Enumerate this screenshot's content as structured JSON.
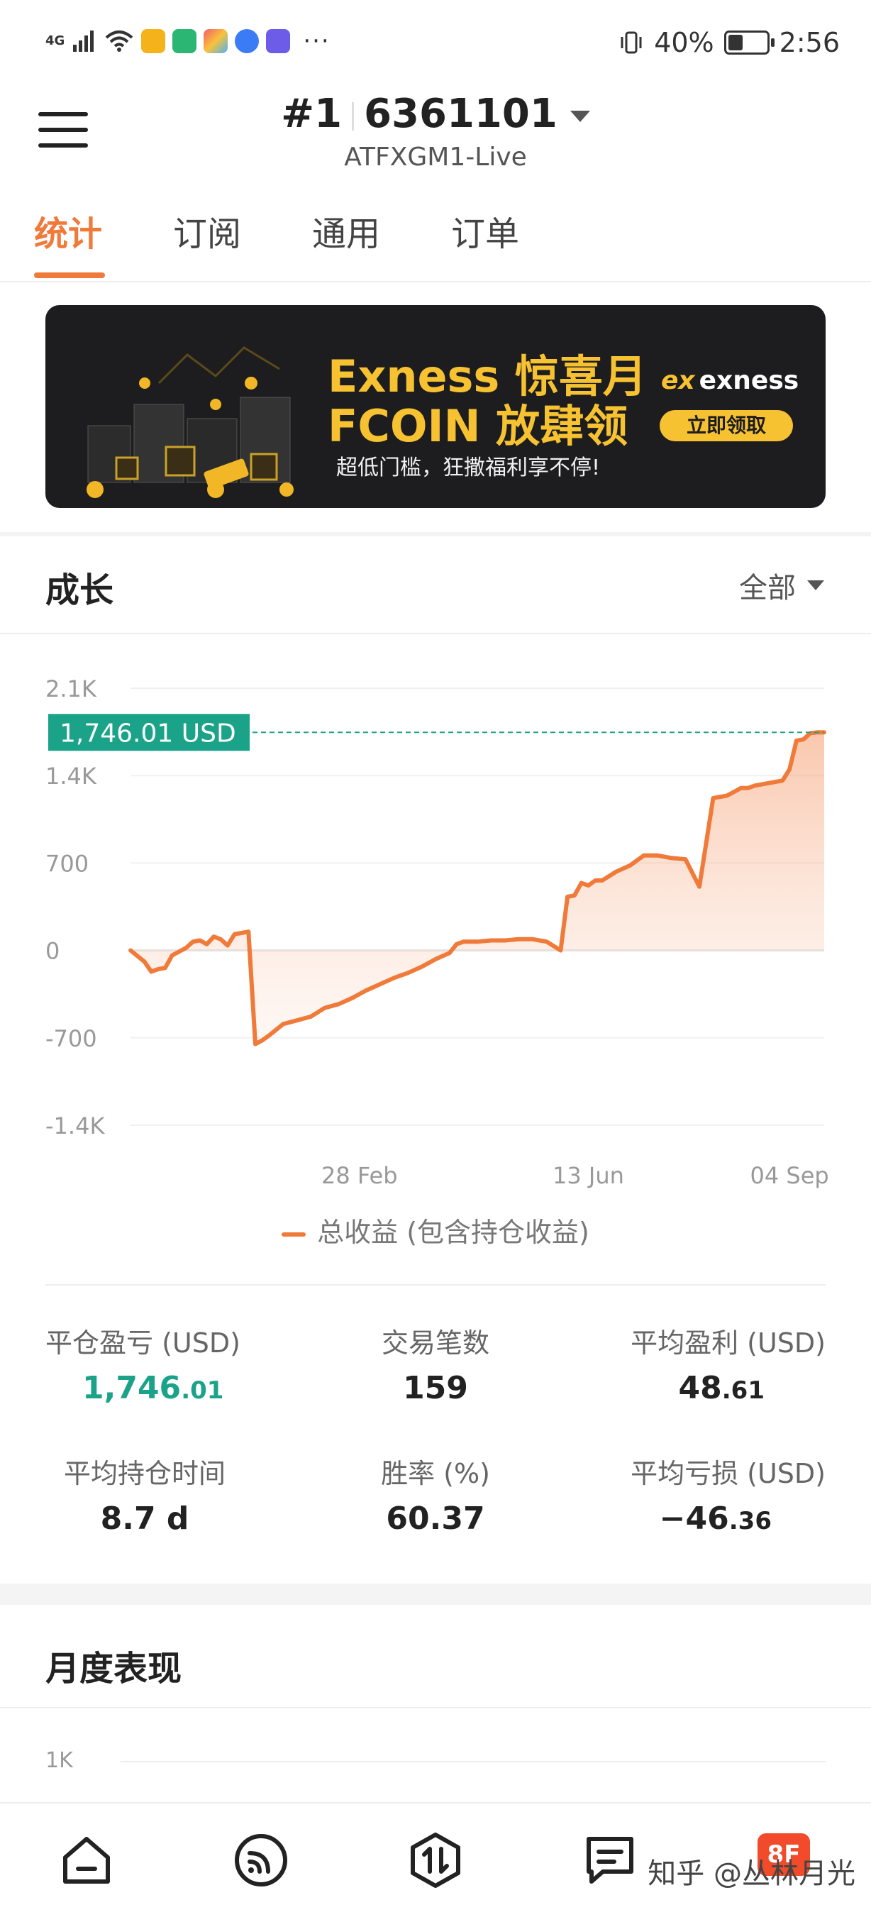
{
  "status_bar": {
    "network": "4G",
    "battery": "40%",
    "battery_level": 0.4,
    "time": "2:56",
    "overflow": "···"
  },
  "header": {
    "account_prefix": "#1",
    "account_number": "6361101",
    "server": "ATFXGM1-Live"
  },
  "tabs": [
    {
      "label": "统计",
      "active": true
    },
    {
      "label": "订阅",
      "active": false
    },
    {
      "label": "通用",
      "active": false
    },
    {
      "label": "订单",
      "active": false
    }
  ],
  "banner": {
    "title_line1": "Exness 惊喜月",
    "title_line2": "FCOIN 放肆领",
    "subtitle": "超低门槛，狂撒福利享不停!",
    "logo": "exness",
    "logo_mark": "ex",
    "button": "立即领取",
    "colors": {
      "background": "#1d1d1f",
      "accent": "#f7c231"
    }
  },
  "growth": {
    "title": "成长",
    "filter": "全部",
    "current_label": "1,746.01 USD",
    "legend": "总收益 (包含持仓收益)"
  },
  "chart_data": {
    "type": "area",
    "y_tick_labels": [
      "2.1K",
      "1.4K",
      "700",
      "0",
      "-700",
      "-1.4K"
    ],
    "y_ticks": [
      2100,
      1400,
      700,
      0,
      -700,
      -1400
    ],
    "ylim": [
      -1400,
      2100
    ],
    "x_tick_labels": [
      "28 Feb",
      "13 Jun",
      "04 Sep"
    ],
    "x_ticks": [
      0.33,
      0.66,
      0.95
    ],
    "current_value": 1746.01,
    "line_color": "#f07a3a",
    "reference_color": "#1ba38a",
    "series": [
      {
        "name": "总收益 (包含持仓收益)",
        "x": [
          0,
          0.02,
          0.03,
          0.04,
          0.05,
          0.06,
          0.08,
          0.09,
          0.1,
          0.11,
          0.12,
          0.13,
          0.14,
          0.15,
          0.16,
          0.17,
          0.18,
          0.19,
          0.2,
          0.22,
          0.24,
          0.26,
          0.28,
          0.3,
          0.32,
          0.34,
          0.36,
          0.38,
          0.4,
          0.42,
          0.44,
          0.46,
          0.47,
          0.48,
          0.5,
          0.52,
          0.54,
          0.56,
          0.58,
          0.6,
          0.62,
          0.63,
          0.64,
          0.65,
          0.66,
          0.67,
          0.68,
          0.7,
          0.72,
          0.74,
          0.76,
          0.78,
          0.8,
          0.82,
          0.84,
          0.86,
          0.87,
          0.88,
          0.89,
          0.9,
          0.92,
          0.94,
          0.95,
          0.96,
          0.97,
          0.98,
          0.99,
          1.0
        ],
        "y": [
          0,
          -90,
          -170,
          -150,
          -140,
          -40,
          20,
          70,
          80,
          50,
          110,
          90,
          40,
          130,
          140,
          150,
          -750,
          -720,
          -680,
          -590,
          -560,
          -530,
          -460,
          -430,
          -380,
          -320,
          -270,
          -220,
          -180,
          -130,
          -70,
          -20,
          50,
          70,
          70,
          80,
          80,
          90,
          90,
          70,
          0,
          430,
          440,
          540,
          520,
          560,
          560,
          630,
          680,
          760,
          760,
          740,
          730,
          510,
          1220,
          1240,
          1270,
          1300,
          1300,
          1320,
          1340,
          1360,
          1450,
          1680,
          1690,
          1740,
          1746,
          1746
        ]
      }
    ]
  },
  "stats": [
    {
      "label": "平仓盈亏 (USD)",
      "int": "1,746",
      "dec": ".01",
      "green": true
    },
    {
      "label": "交易笔数",
      "int": "159",
      "dec": "",
      "green": false
    },
    {
      "label": "平均盈利 (USD)",
      "int": "48",
      "dec": ".61",
      "green": false
    },
    {
      "label": "平均持仓时间",
      "int": "8.7 d",
      "dec": "",
      "green": false
    },
    {
      "label": "胜率 (%)",
      "int": "60.37",
      "dec": "",
      "green": false
    },
    {
      "label": "平均亏损 (USD)",
      "int": "−46",
      "dec": ".36",
      "green": false
    }
  ],
  "monthly": {
    "title": "月度表现",
    "y_axis_label": "1K"
  },
  "bottom_nav": {
    "badge": "8F",
    "watermark": "知乎 @丛林月光"
  }
}
